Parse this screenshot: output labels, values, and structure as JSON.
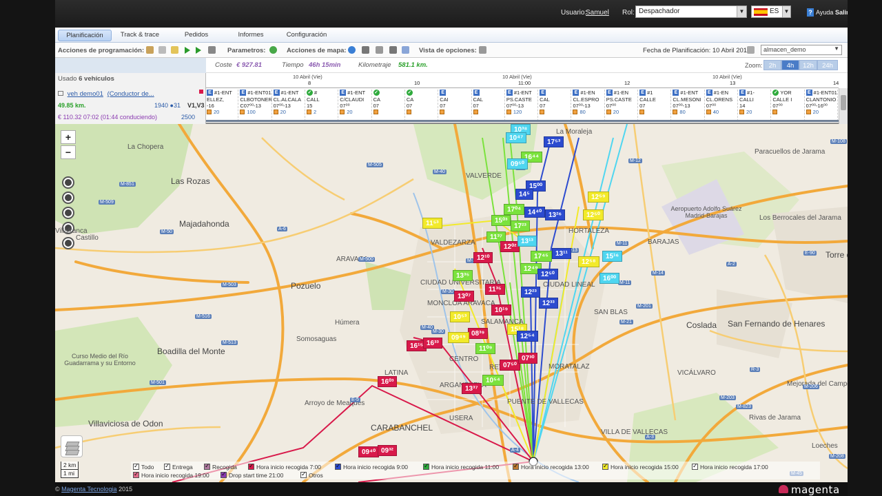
{
  "userbar": {
    "user_label": "Usuario:",
    "user_name": "Samuel",
    "role_label": "Rol:",
    "role_value": "Despachador",
    "lang": "ES",
    "help": "Ayuda",
    "logout": "Salir"
  },
  "nav": {
    "tabs": [
      "Planificación",
      "Track & trace",
      "Pedidos",
      "Informes",
      "Configuración"
    ],
    "active": "Planificación"
  },
  "toolbar": {
    "prog_actions": "Acciones de programación:",
    "params": "Parametros:",
    "map_actions": "Acciones de mapa:",
    "view_options": "Vista de opciones:",
    "plan_date": "Fecha de Planificación: 10 Abril 2015",
    "warehouse": "almacen_demo"
  },
  "stats": {
    "used_label": "Usado",
    "used_value": "6 vehículos",
    "cost_label": "Coste",
    "cost_value": "€ 927.81",
    "time_label": "Tiempo",
    "time_value": "46h 15min",
    "km_label": "Kilometraje",
    "km_value": "581.1 km.",
    "zoom_label": "Zoom:",
    "zoom_options": [
      "2h",
      "4h",
      "12h",
      "24h"
    ],
    "zoom_selected": "4h"
  },
  "timeline": {
    "vehicle": "veh demo01",
    "driver": "(Conductor de...",
    "km": "49.85 km.",
    "load": "1940 ●31",
    "vtype": "V1,V3",
    "cost_time": "€ 110.32  07:02 (01:44 conduciendo)",
    "capacity": "2500",
    "date_labels": [
      "10 Abril (Vie)",
      "10 Abril (Vie)",
      "10 Abril (Vie)"
    ],
    "hours": [
      "8",
      "10",
      "11:00",
      "12",
      "13",
      "14"
    ],
    "stops": [
      {
        "code": "#1-ENT",
        "a": "ELLEZ,",
        "b": "-16",
        "c": "20",
        "type": "E"
      },
      {
        "code": "#1-ENT01",
        "a": "CLBOTONER",
        "b": "C07⁰⁰-13",
        "c": "100",
        "type": "E"
      },
      {
        "code": "#1-ENT",
        "a": "CL.ALCALA",
        "b": "07⁰⁰-13",
        "c": "20",
        "type": "E"
      },
      {
        "code": "#",
        "a": "CALL",
        "b": "15",
        "c": "2",
        "type": "G"
      },
      {
        "code": "#1-ENT",
        "a": "C/CLAUDI",
        "b": "07⁰⁰",
        "c": "20",
        "type": "E"
      },
      {
        "code": "",
        "a": "CA",
        "b": "07",
        "c": "",
        "type": "G"
      },
      {
        "code": "",
        "a": "CA",
        "b": "07",
        "c": "",
        "type": "G"
      },
      {
        "code": "",
        "a": "CAI",
        "b": "07",
        "c": "",
        "type": "E"
      },
      {
        "code": "",
        "a": "CAL",
        "b": "07",
        "c": "",
        "type": "E"
      },
      {
        "code": "#1-ENT",
        "a": "PS.CASTE",
        "b": "07⁰⁰-13",
        "c": "120",
        "type": "E"
      },
      {
        "code": "",
        "a": "CAL",
        "b": "07",
        "c": "",
        "type": "E"
      },
      {
        "code": "#1-EN",
        "a": "CL.ESPRO",
        "b": "07⁰⁰-13",
        "c": "80",
        "type": "E"
      },
      {
        "code": "#1-EN",
        "a": "PS.CASTE",
        "b": "07⁰⁰",
        "c": "20",
        "type": "E"
      },
      {
        "code": "#1",
        "a": "CALLE",
        "b": "07",
        "c": "",
        "type": "E"
      },
      {
        "code": "#1-ENT",
        "a": "CL.MESONI",
        "b": "07⁰⁰-13",
        "c": "80",
        "type": "E"
      },
      {
        "code": "#1-EN",
        "a": "CL.ORENS",
        "b": "07⁰⁰",
        "c": "40",
        "type": "E"
      },
      {
        "code": "#1-",
        "a": "CALLI",
        "b": "14",
        "c": "20",
        "type": "E"
      },
      {
        "code": "YOR",
        "a": "CALLE I",
        "b": "07⁰⁰",
        "c": "",
        "type": "G"
      },
      {
        "code": "#1-ENT015",
        "a": "CLANTONIO L",
        "b": "07⁰⁰-16⁰⁰",
        "c": "20",
        "type": "E"
      }
    ]
  },
  "map": {
    "places": [
      {
        "t": "La Chopera",
        "big": false
      },
      {
        "t": "Las Rozas",
        "big": true
      },
      {
        "t": "Majadahonda",
        "big": true
      },
      {
        "t": "Pozuelo",
        "big": true
      },
      {
        "t": "Húmera",
        "big": false
      },
      {
        "t": "Somosaguas",
        "big": false
      },
      {
        "t": "Boadilla del Monte",
        "big": true
      },
      {
        "t": "Curso Medio del Río Guadarrama y su Entorno",
        "big": false
      },
      {
        "t": "Villaviciosa de Odon",
        "big": true
      },
      {
        "t": "CARABANCHEL",
        "big": true
      },
      {
        "t": "VALVERDE",
        "big": false
      },
      {
        "t": "La Moraleja",
        "big": false
      },
      {
        "t": "Paracuellos de Jarama",
        "big": false
      },
      {
        "t": "Aeropuerto Adolfo Suárez Madrid-Barajas",
        "big": false
      },
      {
        "t": "Los Berrocales del Jarama",
        "big": false
      },
      {
        "t": "BARAJAS",
        "big": false
      },
      {
        "t": "SAN BLAS",
        "big": false
      },
      {
        "t": "Coslada",
        "big": true
      },
      {
        "t": "San Fernando de Henares",
        "big": true
      },
      {
        "t": "VICÁLVARO",
        "big": false
      },
      {
        "t": "Mejorada del Campo",
        "big": false
      },
      {
        "t": "Rivas de Jarama",
        "big": false
      },
      {
        "t": "Loeches",
        "big": false
      },
      {
        "t": "VILLA DE VALLECAS",
        "big": false
      },
      {
        "t": "Arroyo de Meaques",
        "big": false
      },
      {
        "t": "Castillo",
        "big": false
      },
      {
        "t": "Villafranca",
        "big": false
      },
      {
        "t": "CIUDAD LINEAL",
        "big": false
      },
      {
        "t": "HORTALEZA",
        "big": false
      },
      {
        "t": "LATINA",
        "big": false
      },
      {
        "t": "USERA",
        "big": false
      },
      {
        "t": "PUENTE DE VALLECAS",
        "big": false
      },
      {
        "t": "MONCLOA ARAVACA",
        "big": false
      },
      {
        "t": "SALAMANCA",
        "big": false
      },
      {
        "t": "ARGANZUELA",
        "big": false
      },
      {
        "t": "CENTRO",
        "big": false
      },
      {
        "t": "RETIRO",
        "big": false
      },
      {
        "t": "MORATALAZ",
        "big": false
      },
      {
        "t": "VALDEZARZA",
        "big": false
      },
      {
        "t": "ARAVACA",
        "big": false
      },
      {
        "t": "CIUDAD UNIVERSITARIA",
        "big": false
      },
      {
        "t": "Torre de A",
        "big": true
      }
    ],
    "road_labels": [
      "M-505",
      "M-40",
      "M-851",
      "M-509",
      "A-6",
      "M-50",
      "M-503",
      "M-516",
      "M-513",
      "M-501",
      "M-40",
      "M-500",
      "M-30",
      "A-1",
      "M-12",
      "M-11",
      "M-14",
      "M-21",
      "A-2",
      "M-201",
      "E-90",
      "M-203",
      "A-3",
      "M-823",
      "M-206",
      "M-208",
      "M-45",
      "R-3",
      "A-4",
      "E-5",
      "M-11",
      "M-13",
      "M-108",
      "M-216",
      "M-40",
      "M-30"
    ],
    "markers": [
      {
        "t": "10³⁸",
        "c": "#4fd6f0"
      },
      {
        "t": "10⁴⁷",
        "c": "#4fd6f0"
      },
      {
        "t": "17⁵³",
        "c": "#2c4bcf"
      },
      {
        "t": "16⁴⁴",
        "c": "#7be23d"
      },
      {
        "t": "09⁵⁰",
        "c": "#4fd6f0"
      },
      {
        "t": "15⁰⁰",
        "c": "#2c4bcf"
      },
      {
        "t": "14⁵",
        "c": "#2c4bcf"
      },
      {
        "t": "12⁵⁹",
        "c": "#f2ea2a"
      },
      {
        "t": "17⁰⁴",
        "c": "#7be23d"
      },
      {
        "t": "14⁴⁰",
        "c": "#2c4bcf"
      },
      {
        "t": "13²⁶",
        "c": "#2c4bcf"
      },
      {
        "t": "12⁵⁰",
        "c": "#f2ea2a"
      },
      {
        "t": "11⁵³",
        "c": "#f2ea2a"
      },
      {
        "t": "15⁰³",
        "c": "#7be23d"
      },
      {
        "t": "17²³",
        "c": "#7be23d"
      },
      {
        "t": "11³⁷",
        "c": "#7be23d"
      },
      {
        "t": "12⁰²",
        "c": "#d8194a"
      },
      {
        "t": "13¹³",
        "c": "#4fd6f0"
      },
      {
        "t": "12¹⁰",
        "c": "#d8194a"
      },
      {
        "t": "17⁴⁵",
        "c": "#7be23d"
      },
      {
        "t": "13¹¹",
        "c": "#2c4bcf"
      },
      {
        "t": "12⁵⁸",
        "c": "#f2ea2a"
      },
      {
        "t": "15¹⁶",
        "c": "#4fd6f0"
      },
      {
        "t": "12⁴⁹",
        "c": "#7be23d"
      },
      {
        "t": "13³⁵",
        "c": "#7be23d"
      },
      {
        "t": "12⁵⁰",
        "c": "#2c4bcf"
      },
      {
        "t": "16⁰⁰",
        "c": "#4fd6f0"
      },
      {
        "t": "11³⁵",
        "c": "#d8194a"
      },
      {
        "t": "13⁰⁷",
        "c": "#d8194a"
      },
      {
        "t": "12²³",
        "c": "#2c4bcf"
      },
      {
        "t": "12³³",
        "c": "#2c4bcf"
      },
      {
        "t": "10¹⁹",
        "c": "#d8194a"
      },
      {
        "t": "10⁵³",
        "c": "#f2ea2a"
      },
      {
        "t": "15¹⁸",
        "c": "#f2ea2a"
      },
      {
        "t": "12⁵⁴",
        "c": "#2c4bcf"
      },
      {
        "t": "08³⁹",
        "c": "#d8194a"
      },
      {
        "t": "09⁴⁹",
        "c": "#f2ea2a"
      },
      {
        "t": "16¹⁵",
        "c": "#d8194a"
      },
      {
        "t": "16³³",
        "c": "#d8194a"
      },
      {
        "t": "11⁰⁹",
        "c": "#7be23d"
      },
      {
        "t": "07⁵⁰",
        "c": "#d8194a"
      },
      {
        "t": "07³⁰",
        "c": "#d8194a"
      },
      {
        "t": "16⁰³",
        "c": "#d8194a"
      },
      {
        "t": "10⁵⁴",
        "c": "#7be23d"
      },
      {
        "t": "13³⁷",
        "c": "#d8194a"
      },
      {
        "t": "09⁴⁰",
        "c": "#d8194a"
      },
      {
        "t": "09³²",
        "c": "#d8194a"
      }
    ],
    "scale": [
      "2 km",
      "1 mi"
    ],
    "legend": [
      {
        "t": "Todo",
        "c": "#ffffff"
      },
      {
        "t": "Entrega",
        "c": "#ffffff"
      },
      {
        "t": "Recogida",
        "c": "#b07aa0"
      },
      {
        "t": "Hora inicio recogida 7:00",
        "c": "#d8194a"
      },
      {
        "t": "Hora inicio recogida 9:00",
        "c": "#2c4bcf"
      },
      {
        "t": "Hora inicio recogida 11:00",
        "c": "#2eaa3c"
      },
      {
        "t": "Hora inicio recogida 13:00",
        "c": "#c07a30"
      },
      {
        "t": "Hora inicio recogida 15:00",
        "c": "#f2ea2a"
      },
      {
        "t": "Hora inicio recogida 17:00",
        "c": "#ffffff"
      },
      {
        "t": "Hora inicio recogida 19:00",
        "c": "#e06a8a"
      },
      {
        "t": "Drop start time 21:00",
        "c": "#8a3ab0"
      },
      {
        "t": "Otros",
        "c": "#ffffff"
      }
    ]
  },
  "footer": {
    "company": "Magenta Tecnologia",
    "year": "2015",
    "brand": "magenta"
  }
}
